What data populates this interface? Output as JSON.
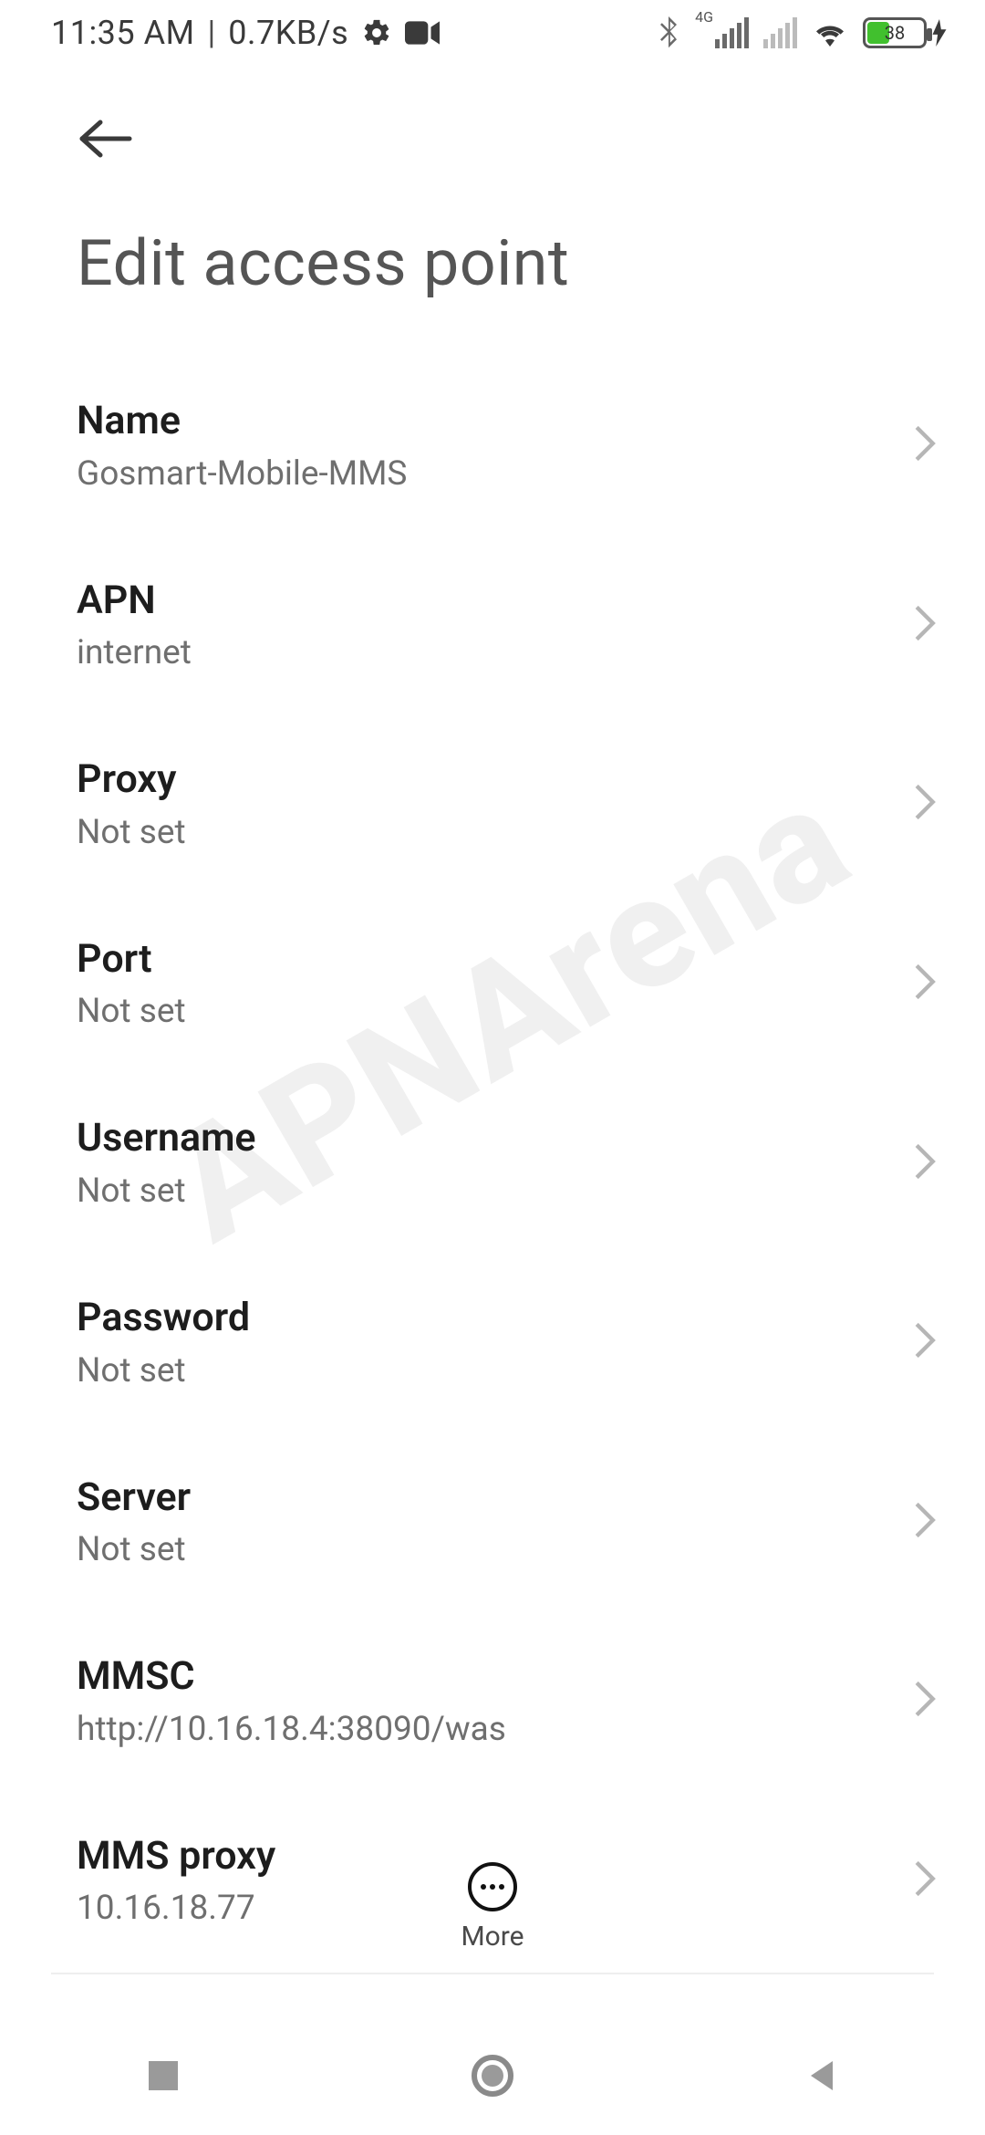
{
  "status": {
    "time": "11:35 AM",
    "speed": "0.7KB/s",
    "network_label": "4G",
    "battery_pct": "38",
    "battery_fill_pct": 38
  },
  "header": {
    "title": "Edit access point"
  },
  "watermark": "APNArena",
  "rows": [
    {
      "key": "name",
      "label": "Name",
      "value": "Gosmart-Mobile-MMS"
    },
    {
      "key": "apn",
      "label": "APN",
      "value": "internet"
    },
    {
      "key": "proxy",
      "label": "Proxy",
      "value": "Not set"
    },
    {
      "key": "port",
      "label": "Port",
      "value": "Not set"
    },
    {
      "key": "username",
      "label": "Username",
      "value": "Not set"
    },
    {
      "key": "password",
      "label": "Password",
      "value": "Not set"
    },
    {
      "key": "server",
      "label": "Server",
      "value": "Not set"
    },
    {
      "key": "mmsc",
      "label": "MMSC",
      "value": "http://10.16.18.4:38090/was"
    },
    {
      "key": "mms_proxy",
      "label": "MMS proxy",
      "value": "10.16.18.77"
    }
  ],
  "actions": {
    "more_label": "More"
  }
}
